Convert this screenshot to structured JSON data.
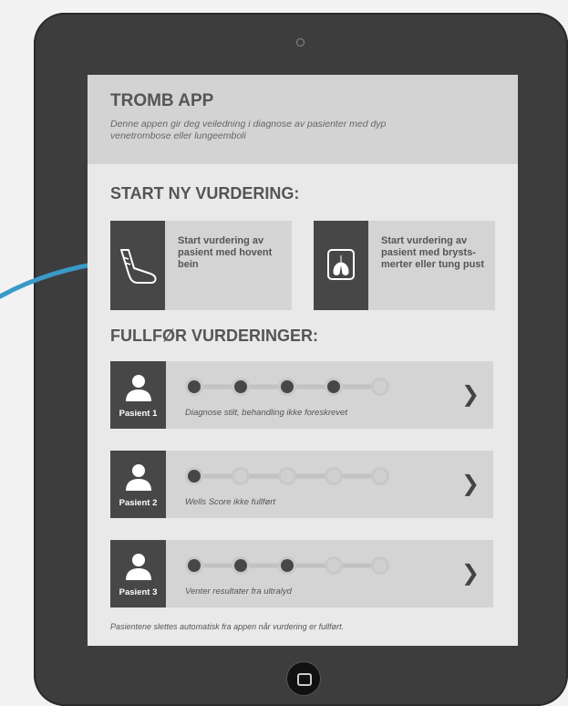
{
  "app": {
    "title": "TROMB APP",
    "description": "Denne appen gir deg veiledning i diagnose av pasienter med dyp venetrombose eller lungeemboli"
  },
  "start_section": {
    "title": "START NY VURDERING:",
    "cards": [
      {
        "label": "Start vurdering av pasient med hovent bein",
        "icon": "leg-icon"
      },
      {
        "label": "Start vurdering av pasient med brysts-merter eller tung pust",
        "icon": "lungs-icon"
      }
    ]
  },
  "complete_section": {
    "title": "FULLFØR VURDERINGER:",
    "patients": [
      {
        "name": "Pasient 1",
        "status": "Diagnose stilt, behandling ikke foreskrevet",
        "progress_filled": 4,
        "progress_total": 5
      },
      {
        "name": "Pasient 2",
        "status": "Wells Score ikke fullført",
        "progress_filled": 1,
        "progress_total": 5
      },
      {
        "name": "Pasient 3",
        "status": "Venter resultater fra ultralyd",
        "progress_filled": 3,
        "progress_total": 5
      }
    ]
  },
  "footnote": "Pasientene slettes automatisk fra appen når vurdering er fullført.",
  "colors": {
    "dark_box": "#474747",
    "card_bg": "#d4d4d4",
    "header_bg": "#d3d3d3",
    "annotation_arrow": "#3a9ac7"
  }
}
